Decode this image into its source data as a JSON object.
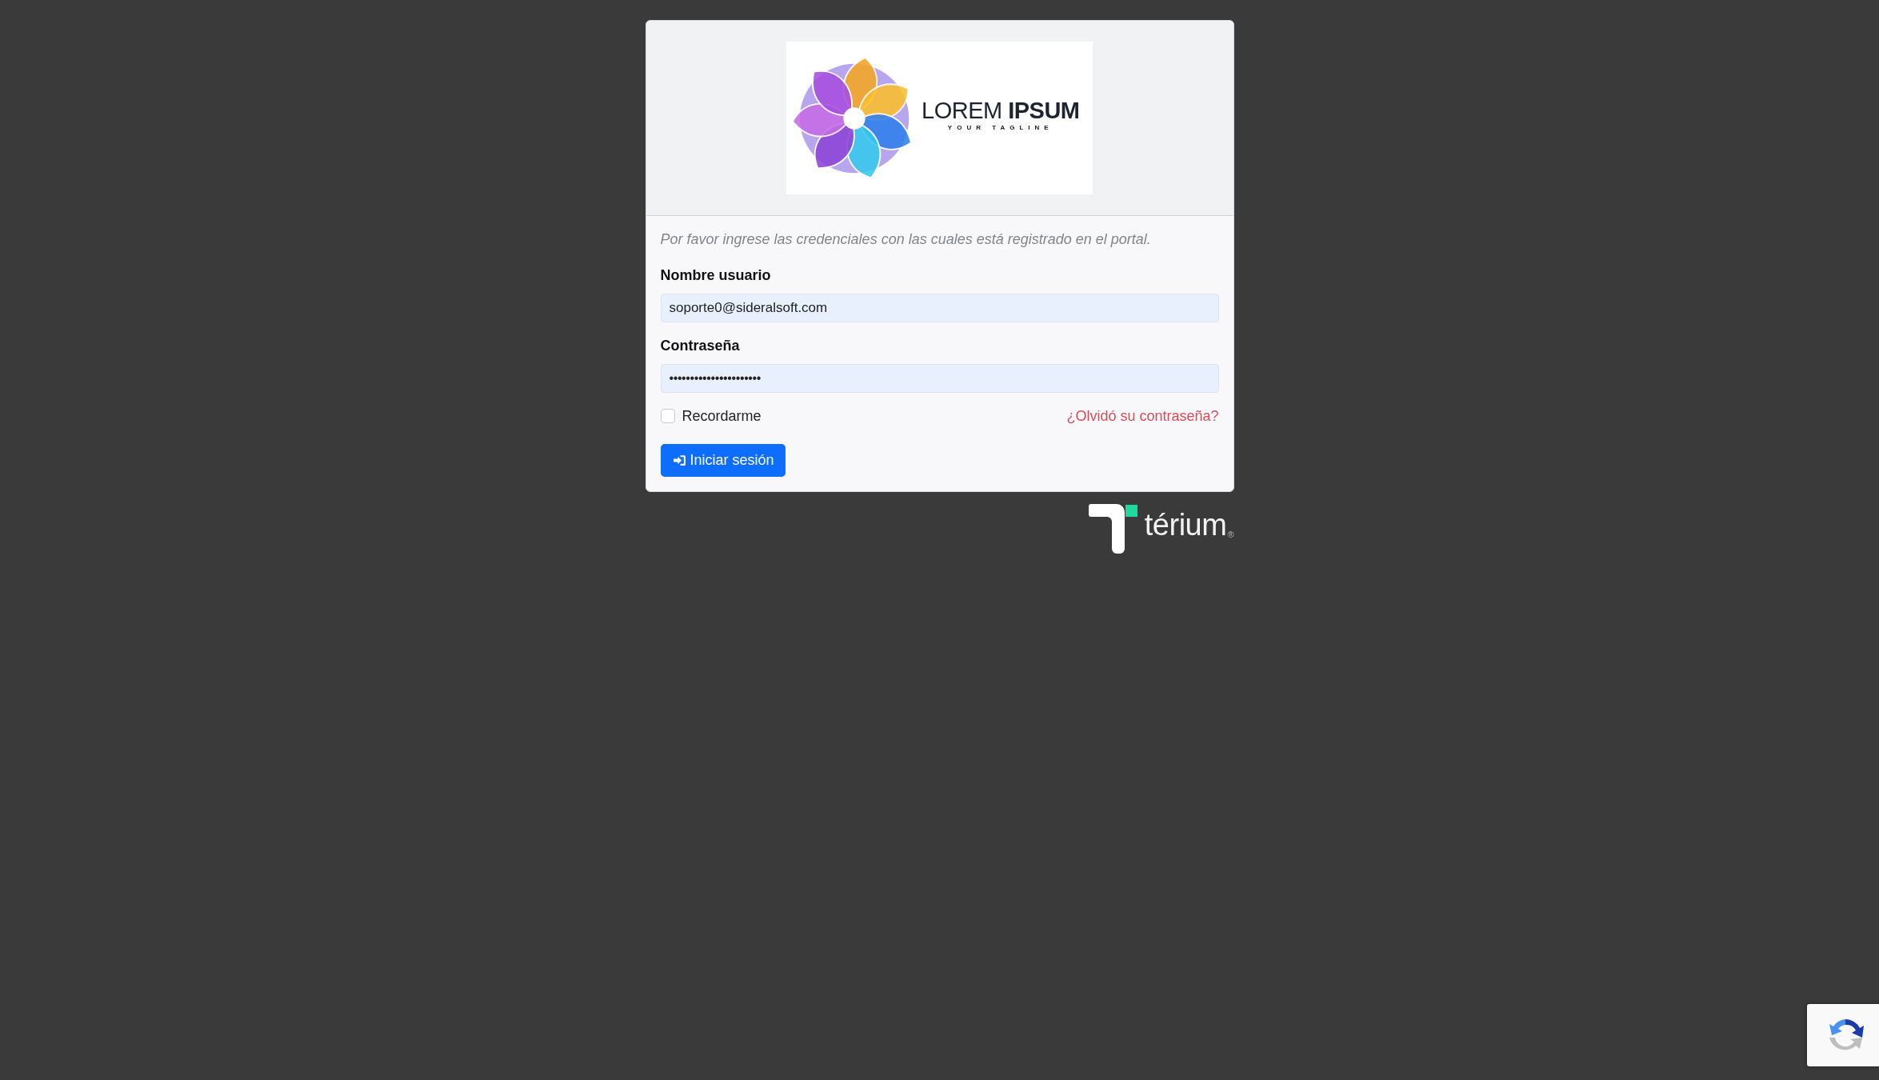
{
  "logo": {
    "name": "LOREM **IPSUM**",
    "tagline": "YOUR TAGLINE"
  },
  "instructions": "Por favor ingrese las credenciales con las cuales está registrado en el portal.",
  "fields": [
    {
      "kind": "text",
      "label": "Nombre usuario",
      "value": "soporte0@sideralsoft.com"
    },
    {
      "kind": "password",
      "label": "Contraseña",
      "value": "••••••••••••••••••••••"
    }
  ],
  "remember": {
    "label": "Recordarme",
    "checked": false
  },
  "forgot_link": "¿Olvidó su contraseña?",
  "submit_button": "Iniciar sesión",
  "brand": {
    "name": "térium",
    "registered": "®"
  }
}
